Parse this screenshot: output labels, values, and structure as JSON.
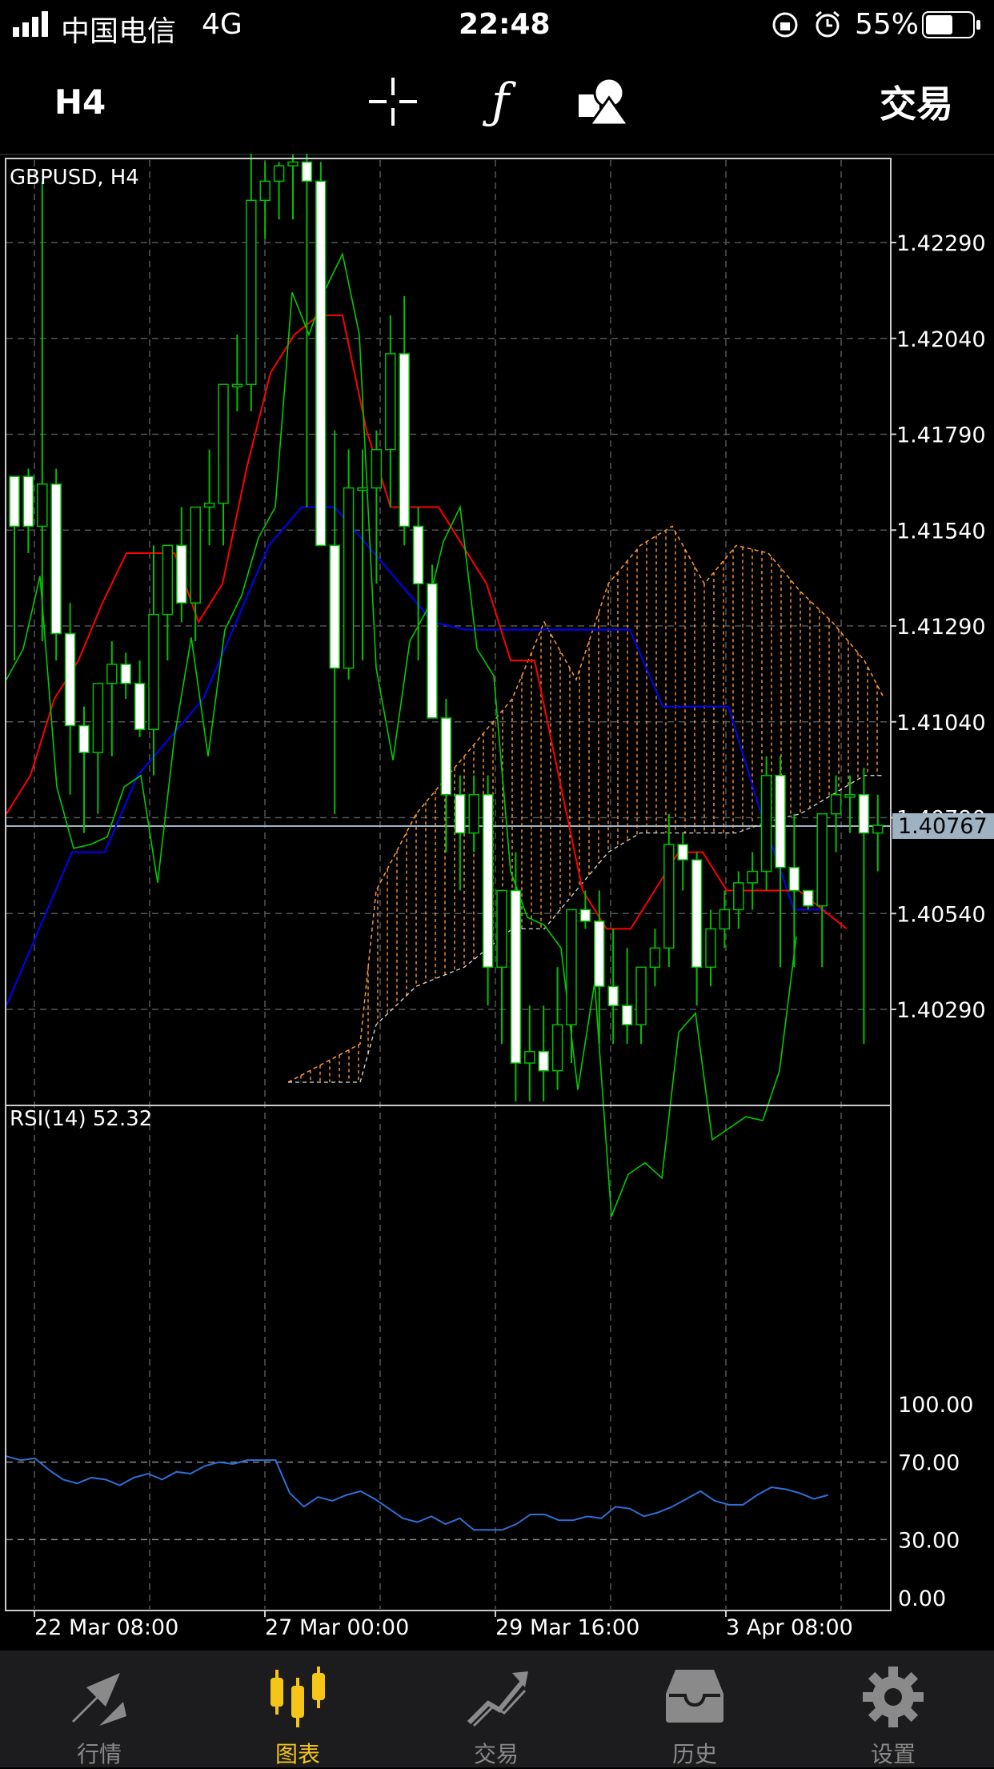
{
  "status": {
    "carrier": "中国电信",
    "network": "4G",
    "time": "22:48",
    "battery": "55%"
  },
  "toolbar": {
    "timeframe": "H4",
    "trade_label": "交易",
    "icons": [
      "crosshair-icon",
      "function-icon",
      "objects-icon"
    ]
  },
  "chart": {
    "symbol_label": "GBPUSD, H4",
    "price_ticks": [
      "1.42290",
      "1.42040",
      "1.41790",
      "1.41540",
      "1.41290",
      "1.41040",
      "1.40790",
      "1.40540",
      "1.40290"
    ],
    "current_price": "1.40767",
    "date_ticks": [
      "22 Mar 08:00",
      "27 Mar 00:00",
      "29 Mar 16:00",
      "3 Apr 08:00"
    ]
  },
  "rsi": {
    "label": "RSI(14) 52.32",
    "ticks": [
      "100.00",
      "70.00",
      "30.00",
      "0.00"
    ]
  },
  "colors": {
    "bull": "#00c000",
    "bear": "#ffffff",
    "tenkan": "#ff0000",
    "kijun": "#0000ff",
    "chikou": "#00cc00",
    "cloud": "#ff9933",
    "rsi": "#2f6fd6"
  },
  "tabs": [
    {
      "label": "行情",
      "icon": "quotes-icon",
      "active": false
    },
    {
      "label": "图表",
      "icon": "chart-icon",
      "active": true
    },
    {
      "label": "交易",
      "icon": "trade-icon",
      "active": false
    },
    {
      "label": "历史",
      "icon": "history-icon",
      "active": false
    },
    {
      "label": "设置",
      "icon": "settings-icon",
      "active": false
    }
  ],
  "chart_data": {
    "type": "candlestick",
    "title": "GBPUSD, H4",
    "ylim": [
      1.401,
      1.425
    ],
    "candles": [
      [
        1.4168,
        1.4168,
        1.412,
        1.4155
      ],
      [
        1.4168,
        1.417,
        1.4148,
        1.4155
      ],
      [
        1.4155,
        1.4245,
        1.4125,
        1.4166
      ],
      [
        1.4166,
        1.417,
        1.412,
        1.4127
      ],
      [
        1.4127,
        1.4135,
        1.4085,
        1.4103
      ],
      [
        1.4103,
        1.4108,
        1.4075,
        1.4096
      ],
      [
        1.4096,
        1.41,
        1.408,
        1.4114
      ],
      [
        1.4114,
        1.4125,
        1.4095,
        1.4119
      ],
      [
        1.4119,
        1.4122,
        1.411,
        1.4114
      ],
      [
        1.4114,
        1.412,
        1.41,
        1.4102
      ],
      [
        1.4102,
        1.415,
        1.409,
        1.4132
      ],
      [
        1.4132,
        1.415,
        1.412,
        1.415
      ],
      [
        1.415,
        1.416,
        1.413,
        1.4135
      ],
      [
        1.4135,
        1.4155,
        1.4125,
        1.416
      ],
      [
        1.416,
        1.4175,
        1.415,
        1.4161
      ],
      [
        1.4161,
        1.417,
        1.415,
        1.4192
      ],
      [
        1.4192,
        1.4205,
        1.4185,
        1.4192
      ],
      [
        1.4192,
        1.4255,
        1.4185,
        1.424
      ],
      [
        1.424,
        1.425,
        1.423,
        1.4245
      ],
      [
        1.4245,
        1.425,
        1.4235,
        1.4249
      ],
      [
        1.4249,
        1.4252,
        1.4235,
        1.425
      ],
      [
        1.425,
        1.4255,
        1.416,
        1.4245
      ],
      [
        1.4245,
        1.425,
        1.415,
        1.415
      ],
      [
        1.415,
        1.418,
        1.408,
        1.4118
      ],
      [
        1.4118,
        1.4175,
        1.4115,
        1.4165
      ],
      [
        1.4165,
        1.4175,
        1.412,
        1.4165
      ],
      [
        1.4165,
        1.418,
        1.414,
        1.4175
      ],
      [
        1.4175,
        1.421,
        1.416,
        1.42
      ],
      [
        1.42,
        1.4215,
        1.415,
        1.4155
      ],
      [
        1.4155,
        1.416,
        1.412,
        1.414
      ],
      [
        1.414,
        1.4145,
        1.4105,
        1.4105
      ],
      [
        1.4105,
        1.411,
        1.407,
        1.4085
      ],
      [
        1.4085,
        1.409,
        1.406,
        1.4075
      ],
      [
        1.4075,
        1.409,
        1.407,
        1.4085
      ],
      [
        1.4085,
        1.409,
        1.403,
        1.404
      ],
      [
        1.404,
        1.406,
        1.402,
        1.406
      ],
      [
        1.406,
        1.407,
        1.4005,
        1.4015
      ],
      [
        1.4015,
        1.403,
        1.4005,
        1.4018
      ],
      [
        1.4018,
        1.403,
        1.4005,
        1.4013
      ],
      [
        1.4013,
        1.404,
        1.4008,
        1.4025
      ],
      [
        1.4025,
        1.4055,
        1.4015,
        1.4055
      ],
      [
        1.4055,
        1.406,
        1.405,
        1.4052
      ],
      [
        1.4052,
        1.406,
        1.402,
        1.4035
      ],
      [
        1.4035,
        1.405,
        1.402,
        1.403
      ],
      [
        1.403,
        1.4045,
        1.402,
        1.4025
      ],
      [
        1.4025,
        1.404,
        1.402,
        1.404
      ],
      [
        1.404,
        1.405,
        1.4035,
        1.4045
      ],
      [
        1.4045,
        1.408,
        1.404,
        1.4072
      ],
      [
        1.4072,
        1.4075,
        1.406,
        1.4068
      ],
      [
        1.4068,
        1.407,
        1.403,
        1.404
      ],
      [
        1.404,
        1.4055,
        1.4035,
        1.405
      ],
      [
        1.405,
        1.406,
        1.4045,
        1.4055
      ],
      [
        1.4055,
        1.4065,
        1.405,
        1.4062
      ],
      [
        1.4062,
        1.407,
        1.4055,
        1.4065
      ],
      [
        1.4065,
        1.4095,
        1.406,
        1.409
      ],
      [
        1.409,
        1.4095,
        1.404,
        1.4066
      ],
      [
        1.4066,
        1.408,
        1.404,
        1.406
      ],
      [
        1.406,
        1.406,
        1.4055,
        1.4056
      ],
      [
        1.4056,
        1.408,
        1.404,
        1.408
      ],
      [
        1.408,
        1.409,
        1.407,
        1.4085
      ],
      [
        1.4085,
        1.409,
        1.4075,
        1.4085
      ],
      [
        1.4085,
        1.4092,
        1.402,
        1.4075
      ],
      [
        1.4075,
        1.4085,
        1.4065,
        1.4077
      ]
    ],
    "tenkan": [
      1.408,
      1.409,
      1.411,
      1.412,
      1.4135,
      1.4148,
      1.4148,
      1.4148,
      1.413,
      1.414,
      1.417,
      1.4195,
      1.4205,
      1.421,
      1.421,
      1.418,
      1.416,
      1.416,
      1.416,
      1.415,
      1.414,
      1.412,
      1.412,
      1.409,
      1.406,
      1.405,
      1.405,
      1.406,
      1.407,
      1.407,
      1.406,
      1.406,
      1.406,
      1.406,
      1.4055,
      1.405
    ],
    "kijun": [
      1.403,
      1.405,
      1.407,
      1.407,
      1.409,
      1.41,
      1.411,
      1.413,
      1.415,
      1.416,
      1.416,
      1.415,
      1.414,
      1.413,
      1.4128,
      1.4128,
      1.4128,
      1.4128,
      1.4128,
      1.4128,
      1.4108,
      1.4108,
      1.4108,
      1.408,
      1.4055,
      1.4055
    ],
    "rsi": [
      73,
      71,
      72,
      66,
      61,
      59,
      62,
      61,
      58,
      62,
      64,
      61,
      65,
      64,
      68,
      70,
      69,
      71,
      71,
      71,
      54,
      47,
      52,
      50,
      53,
      55,
      51,
      46,
      41,
      39,
      42,
      38,
      41,
      35,
      35,
      35,
      38,
      43,
      43,
      40,
      40,
      42,
      41,
      47,
      46,
      42,
      44,
      47,
      51,
      55,
      50,
      48,
      48,
      53,
      57,
      56,
      54,
      51,
      53
    ]
  }
}
